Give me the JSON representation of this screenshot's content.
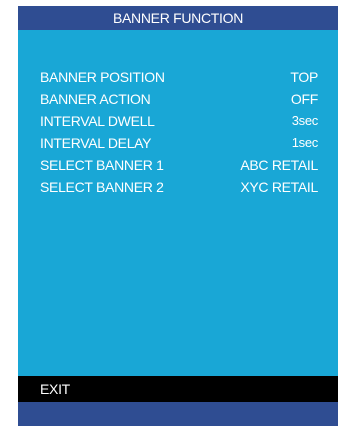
{
  "title": "BANNER FUNCTION",
  "menu": {
    "items": [
      {
        "label": "BANNER POSITION",
        "value": "TOP"
      },
      {
        "label": "BANNER ACTION",
        "value": "OFF"
      },
      {
        "label": "INTERVAL DWELL",
        "value": "3sec"
      },
      {
        "label": "INTERVAL DELAY",
        "value": "1sec"
      },
      {
        "label": "SELECT BANNER  1",
        "value": "ABC RETAIL"
      },
      {
        "label": "SELECT BANNER  2",
        "value": "XYC RETAIL"
      }
    ]
  },
  "exit_label": "EXIT",
  "colors": {
    "background": "#19a7d6",
    "header": "#2f4d92",
    "exit_bar": "#000000",
    "text": "#ffffff"
  }
}
